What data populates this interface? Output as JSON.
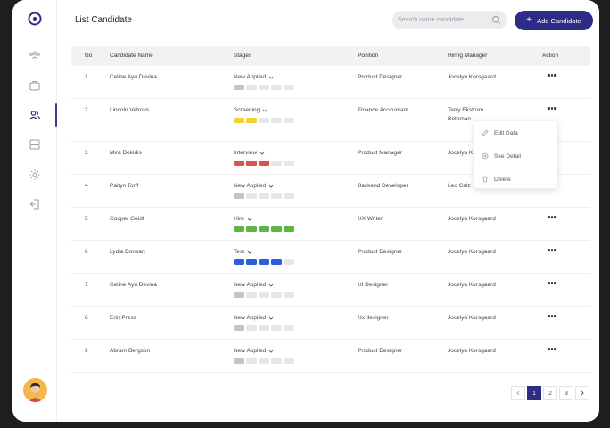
{
  "page": {
    "title": "List Candidate"
  },
  "search": {
    "placeholder": "Search name candidate"
  },
  "add_button": {
    "label": "Add Candidate"
  },
  "colors": {
    "accent": "#2f2c87",
    "gray": "#c4c4c7",
    "yellow": "#f2d22e",
    "red": "#d9534f",
    "green": "#5db544",
    "blue": "#2b5fd9",
    "empty": "#e6e6e9"
  },
  "sidebar": {
    "items": [
      {
        "icon": "team-icon"
      },
      {
        "icon": "briefcase-icon"
      },
      {
        "icon": "users-icon",
        "active": true
      },
      {
        "icon": "server-icon"
      },
      {
        "icon": "settings-icon"
      },
      {
        "icon": "logout-icon"
      }
    ]
  },
  "table": {
    "headers": [
      "No",
      "Candidate Name",
      "Stages",
      "Position",
      "Hiring Manager",
      "Action"
    ],
    "rows": [
      {
        "no": "1",
        "name": "Celine Ayu Devina",
        "stage": "New Applied",
        "level": 1,
        "color": "gray",
        "position": "Product Designer",
        "manager": "Jocelyn Korsgaard",
        "manager2": ""
      },
      {
        "no": "2",
        "name": "Lincoln Vetrovs",
        "stage": "Screening",
        "level": 2,
        "color": "yellow",
        "position": "Finance Accountant",
        "manager": "Terry Ekstrom",
        "manager2": "Bothman"
      },
      {
        "no": "3",
        "name": "Mira Dokidis",
        "stage": "Interview",
        "level": 3,
        "color": "red",
        "position": "Product Manager",
        "manager": "Jocelyn K",
        "manager2": ""
      },
      {
        "no": "4",
        "name": "Paityn Torff",
        "stage": "New Applied",
        "level": 1,
        "color": "gray",
        "position": "Backend Developer",
        "manager": "Leo Calz",
        "manager2": ""
      },
      {
        "no": "5",
        "name": "Cooper Geidt",
        "stage": "Hire",
        "level": 5,
        "color": "green",
        "position": "UX Writer",
        "manager": "Jocelyn Korsgaard",
        "manager2": ""
      },
      {
        "no": "6",
        "name": "Lydia Dorwart",
        "stage": "Test",
        "level": 4,
        "color": "blue",
        "position": "Product Designer",
        "manager": "Jocelyn Korsgaard",
        "manager2": ""
      },
      {
        "no": "7",
        "name": "Celine Ayu Devina",
        "stage": "New Applied",
        "level": 1,
        "color": "gray",
        "position": "UI Designer",
        "manager": "Jocelyn Korsgaard",
        "manager2": ""
      },
      {
        "no": "8",
        "name": "Erin Press",
        "stage": "New Applied",
        "level": 1,
        "color": "gray",
        "position": "Ux designer",
        "manager": "Jocelyn Korsgaard",
        "manager2": ""
      },
      {
        "no": "9",
        "name": "Abram Bergson",
        "stage": "New Applied",
        "level": 1,
        "color": "gray",
        "position": "Product Designer",
        "manager": "Jocelyn Korsgaard",
        "manager2": ""
      }
    ]
  },
  "context_menu": {
    "items": [
      {
        "label": "Edit Data",
        "icon": "edit-icon"
      },
      {
        "label": "See Detail",
        "icon": "eye-icon"
      },
      {
        "label": "Delete",
        "icon": "trash-icon"
      }
    ]
  },
  "pagination": {
    "pages": [
      "1",
      "2",
      "3"
    ],
    "current": "1"
  }
}
